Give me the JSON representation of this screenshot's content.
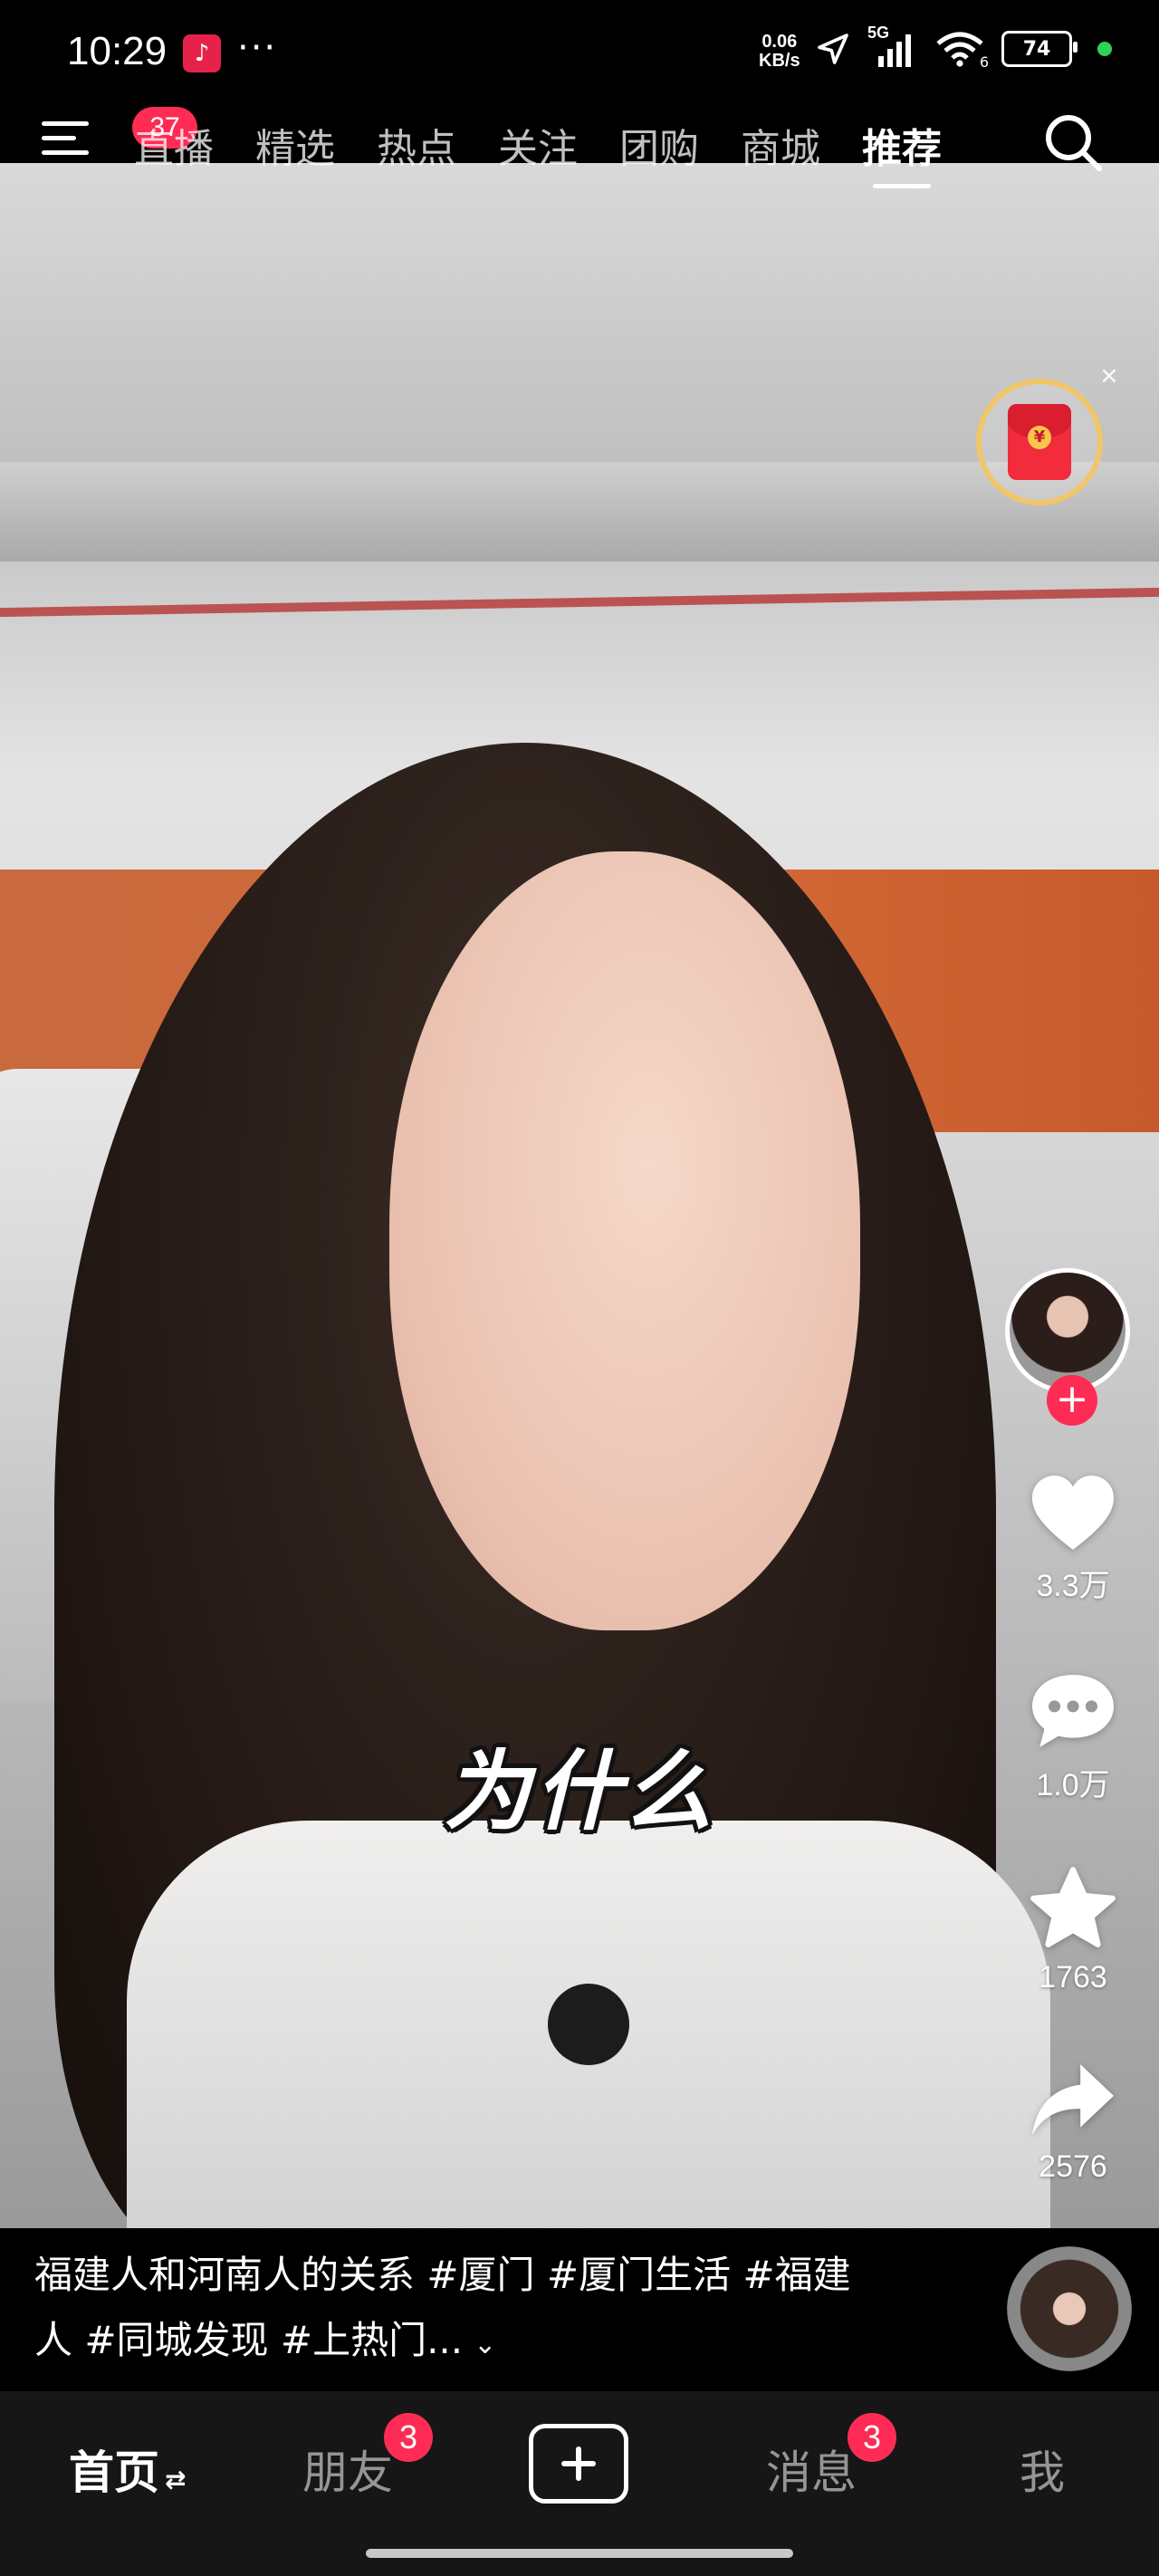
{
  "status_bar": {
    "time": "10:29",
    "app_icon": "tiktok-icon",
    "more": "···",
    "net_speed_value": "0.06",
    "net_speed_unit": "KB/s",
    "signal": "5G",
    "wifi_sub": "6",
    "battery": "74"
  },
  "top_nav": {
    "menu_badge": "37",
    "tabs": [
      "直播",
      "精选",
      "热点",
      "关注",
      "团购",
      "商城",
      "推荐"
    ],
    "active_tab": "推荐"
  },
  "red_packet": {
    "close": "×",
    "coin": "¥"
  },
  "video": {
    "subtitle": "为什么"
  },
  "actions": {
    "follow": "+",
    "likes": "3.3万",
    "comments": "1.0万",
    "favorites": "1763",
    "shares": "2576"
  },
  "description": {
    "text": "福建人和河南人的关系 #厦门 #厦门生活 #福建人 #同城发现 #上热门...",
    "expand": "⌄"
  },
  "bottom_nav": {
    "home": "首页",
    "home_swap": "⇄",
    "friends": "朋友",
    "friends_badge": "3",
    "messages": "消息",
    "messages_badge": "3",
    "me": "我"
  },
  "colors": {
    "accent": "#fe2c55",
    "background": "#000000",
    "tabbar": "#161616"
  }
}
